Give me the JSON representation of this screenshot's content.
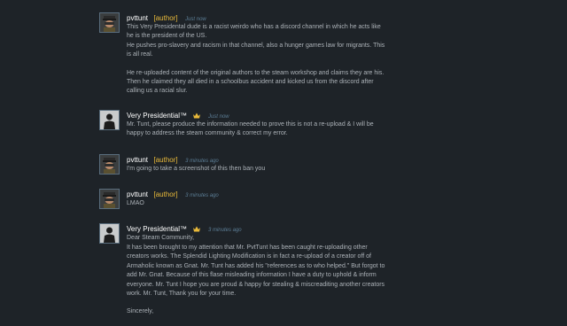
{
  "comments": [
    {
      "author": "pvttunt",
      "author_tag": "[author]",
      "time": "Just now",
      "avatar": "pvttunt-avatar",
      "lines": [
        "This Very Presidental dude is a racist weirdo who has a discord channel in which he acts like",
        "he is the president of the US.",
        "He pushes pro-slavery and racism in that channel, also a hunger games law for migrants. This",
        "is all real.",
        "",
        "He re-uploaded content of the original authors to the steam workshop and claims they are his.",
        "Then he claimed they all died in a schoolbus accident and kicked us from the discord after",
        "calling us a racial slur."
      ]
    },
    {
      "author": "Very Presidential™",
      "time": "Just now",
      "avatar": "presidential-avatar",
      "lines": [
        "Mr. Tunt, please produce the information needed to prove this is not a re-upload & I will be",
        "happy to address the steam community & correct my error."
      ]
    },
    {
      "author": "pvttunt",
      "author_tag": "[author]",
      "time": "3 minutes ago",
      "avatar": "pvttunt-avatar",
      "lines": [
        "I'm going to take a screenshot of this then ban you"
      ]
    },
    {
      "author": "pvttunt",
      "author_tag": "[author]",
      "time": "3 minutes ago",
      "avatar": "pvttunt-avatar",
      "lines": [
        "LMAO"
      ]
    },
    {
      "author": "Very Presidential™",
      "time": "3 minutes ago",
      "avatar": "presidential-avatar",
      "lines": [
        "Dear Steam Community,",
        "It has been brought to my attention that Mr. PvtTunt has been caught re-uploading other",
        "creators works. The Splendid Lighting Modification is in fact a re-upload of a creator off of",
        "Armaholic known as Gnat. Mr. Tunt has added his \"references as to who helped.\" But forgot to",
        "add Mr. Gnat. Because of this flase misleading information I have a duty to uphold & inform",
        "everyone. Mr. Tunt I hope you are proud & happy for stealing & miscreaditing another creators",
        "work. Mr. Tunt, Thank you for your time.",
        "",
        "Sincerely,"
      ]
    }
  ],
  "colors": {
    "background": "#1e2328",
    "name": "#ffffff",
    "author_tag": "#e8b93a",
    "timestamp": "#5c7e96",
    "body_text": "#acb2b8"
  }
}
